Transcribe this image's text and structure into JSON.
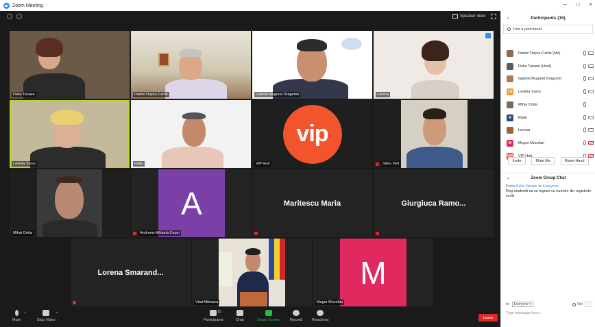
{
  "window": {
    "title": "Zoom Meeting",
    "controls": [
      "–",
      "□",
      "×"
    ]
  },
  "top_right": {
    "view_label": "Speaker View"
  },
  "tiles": [
    {
      "name": "Delia Tanase"
    },
    {
      "name": "Daniel Dejica-Cartis"
    },
    {
      "name": "Gabriel Mugurel Dragomir"
    },
    {
      "name": "Lorena"
    },
    {
      "name": "Lavinia Suciu"
    },
    {
      "name": "Radu"
    },
    {
      "name": "VIP Hub",
      "logo_text": "vip"
    },
    {
      "name": "Silviu Vert"
    },
    {
      "name": "Mihai Onita"
    },
    {
      "name": "Andreea-Mihaela Cepoi",
      "avatar_letter": "A",
      "avatar_color": "#7b3fa8"
    },
    {
      "name": "",
      "big_name": "Maritescu Maria"
    },
    {
      "name": "",
      "big_name": "Giurgiuca Ramo..."
    },
    {
      "name": "",
      "big_name": "Lorena Smarand..."
    },
    {
      "name": "Vlad Mitrasca"
    },
    {
      "name": "Mugur Mocofan",
      "avatar_letter": "M",
      "avatar_color": "#e0295f"
    }
  ],
  "toolbar": {
    "mute": "Mute",
    "stop_video": "Stop Video",
    "participants": "Participants",
    "participants_count": "15",
    "chat": "Chat",
    "share_screen": "Share Screen",
    "record": "Record",
    "reactions": "Reactions",
    "leave": "Leave"
  },
  "participants_panel": {
    "title": "Participants (15)",
    "search_placeholder": "Find a participant",
    "list": [
      {
        "name": "Daniel Dejica-Cartis (Me)",
        "initials": "",
        "color": "#8a6a50",
        "cam_off": false
      },
      {
        "name": "Delia Tanase (Host)",
        "initials": "",
        "color": "#5a5a5a",
        "cam_off": false
      },
      {
        "name": "Gabriel Mugurel Dragomir",
        "initials": "",
        "color": "#b07a50",
        "cam_off": false
      },
      {
        "name": "Lavinia Suciu",
        "initials": "LS",
        "color": "#f0a030",
        "cam_off": false
      },
      {
        "name": "Mihai Onita",
        "initials": "",
        "color": "#7a6a5a",
        "cam_off": false
      },
      {
        "name": "Radu",
        "initials": "R",
        "color": "#2e4a7a",
        "cam_off": false
      },
      {
        "name": "Lorena",
        "initials": "",
        "color": "#a0603a",
        "cam_off": false
      },
      {
        "name": "Mugur Mocofan",
        "initials": "M",
        "color": "#e0295f",
        "cam_off": true
      },
      {
        "name": "VIP Hub",
        "initials": "VIP",
        "color": "#f2542d",
        "cam_off": true
      }
    ],
    "invite": "Invite",
    "mute_me": "Mute Me",
    "raise_hand": "Raise Hand"
  },
  "chat_panel": {
    "title": "Zoom Group Chat",
    "from_prefix": "From",
    "from_name": "Delia Tanase",
    "to_word": "to",
    "to_name": "Everyone",
    "message": "Rog studentii sa se logeze cu numele din registrele scolii",
    "to_label": "to:",
    "to_select": "Everyone ▾",
    "file_label": "File",
    "more": "···",
    "input_placeholder": "Type message here..."
  }
}
